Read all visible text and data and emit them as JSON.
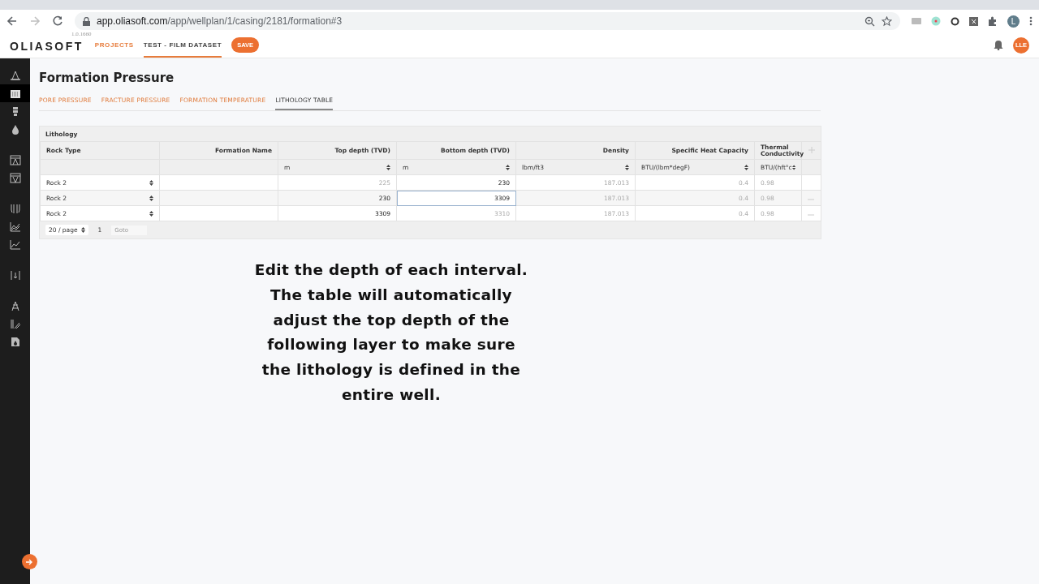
{
  "browser": {
    "url_host": "app.oliasoft.com",
    "url_path": "/app/wellplan/1/casing/2181/formation#3",
    "profile": "L"
  },
  "header": {
    "logo": "OLIASOFT",
    "version": "1.0.1660",
    "nav": [
      {
        "label": "PROJECTS",
        "selected": false
      },
      {
        "label": "TEST - FILM DATASET",
        "selected": true
      }
    ],
    "save": "SAVE",
    "user": "LLE"
  },
  "sidebar": {
    "groups": [
      [
        {
          "selected": false
        },
        {
          "selected": true
        },
        {
          "selected": false
        },
        {
          "selected": false
        }
      ],
      [
        {
          "selected": false
        },
        {
          "selected": false
        }
      ],
      [
        {
          "selected": false
        },
        {
          "selected": false
        },
        {
          "selected": false
        }
      ],
      [
        {
          "selected": false
        }
      ],
      [
        {
          "selected": false
        },
        {
          "selected": false
        },
        {
          "selected": false
        }
      ]
    ]
  },
  "page": {
    "title": "Formation Pressure",
    "tabs": [
      {
        "label": "PORE PRESSURE",
        "selected": false
      },
      {
        "label": "FRACTURE PRESSURE",
        "selected": false
      },
      {
        "label": "FORMATION TEMPERATURE",
        "selected": false
      },
      {
        "label": "LITHOLOGY TABLE",
        "selected": true
      }
    ]
  },
  "table": {
    "title": "Lithology",
    "columns": [
      {
        "label": "Rock Type"
      },
      {
        "label": "Formation Name"
      },
      {
        "label": "Top depth (TVD)",
        "unit": "m"
      },
      {
        "label": "Bottom depth (TVD)",
        "unit": "m"
      },
      {
        "label": "Density",
        "unit": "lbm/ft3"
      },
      {
        "label": "Specific Heat Capacity",
        "unit": "BTU/(lbm*degF)"
      },
      {
        "label": "Thermal Conductivity",
        "unit": "BTU/(hft°c"
      }
    ],
    "rows": [
      {
        "rock_type": "Rock 2",
        "top_depth": {
          "value": "225",
          "muted": true
        },
        "bottom_depth": {
          "value": "230",
          "muted": false,
          "editing": false
        },
        "density": "187.013",
        "heat_capacity": "0.4",
        "conductivity": "0.98",
        "removable": false
      },
      {
        "rock_type": "Rock 2",
        "top_depth": {
          "value": "230",
          "muted": false
        },
        "bottom_depth": {
          "value": "3309",
          "muted": false,
          "editing": true
        },
        "density": "187.013",
        "heat_capacity": "0.4",
        "conductivity": "0.98",
        "removable": true
      },
      {
        "rock_type": "Rock 2",
        "top_depth": {
          "value": "3309",
          "muted": false
        },
        "bottom_depth": {
          "value": "3310",
          "muted": true,
          "editing": false
        },
        "density": "187.013",
        "heat_capacity": "0.4",
        "conductivity": "0.98",
        "removable": true
      }
    ],
    "pagination": {
      "page_size": "20 / page",
      "page": "1",
      "goto_placeholder": "Goto"
    }
  },
  "caption": "Edit the depth of each interval. The table will automatically adjust the top depth of the following layer to make sure the lithology is defined in the entire well."
}
